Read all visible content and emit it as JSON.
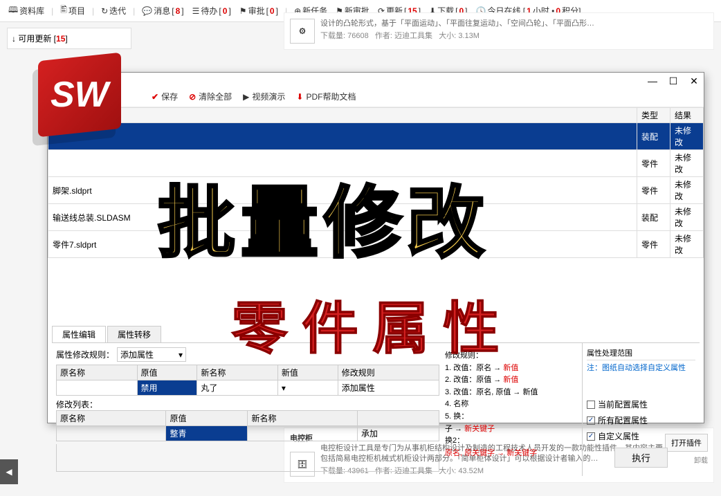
{
  "menu": {
    "items": [
      {
        "label": "资料库"
      },
      {
        "label": "项目"
      },
      {
        "label": "迭代"
      },
      {
        "label": "消息",
        "num": "8"
      },
      {
        "label": "待办",
        "num": "0"
      },
      {
        "label": "审批",
        "num": "0"
      },
      {
        "label": "新任务"
      },
      {
        "label": "新审批"
      },
      {
        "label": "更新",
        "num": "15"
      },
      {
        "label": "下载",
        "num": "0"
      }
    ],
    "today": "今日在线 [",
    "today_hours": "1",
    "today_suffix": " 小时 • ",
    "points": "0",
    "points_suffix": " 积分]"
  },
  "update_box": {
    "icon": "↓",
    "text": "可用更新 [",
    "num": "15",
    "suffix": "]"
  },
  "sw_logo": "SW",
  "bg_card1": {
    "desc": "设计的凸轮形式，基于「平面运动」、「平面往复运动」、「空间凸轮」、「平面凸形…",
    "dl_label": "下载量:",
    "dl": "76608",
    "author_label": "作者:",
    "author": "迈迪工具集",
    "size_label": "大小:",
    "size": "3.13M"
  },
  "bg_card2": {
    "title": "电控柜",
    "desc": "电控柜设计工具是专门为从事机柜结构设计及制造的工程技术人员开发的一款功能性插件。其内容主要包括简易电控柜机械式机柜设计两部分。「简单柜体设计」可以根据设计者输入的…",
    "dl_label": "下载量:",
    "dl": "43961",
    "author_label": "作者:",
    "author": "迈迪工具集",
    "size_label": "大小:",
    "size": "43.52M",
    "btn": "打开插件",
    "btn2": "卸载"
  },
  "dialog": {
    "toolbar": {
      "clear": "清除全部",
      "video": "视频演示",
      "pdf": "PDF帮助文档",
      "save": "保存"
    },
    "headers": {
      "name": "",
      "type": "类型",
      "status": "结果"
    },
    "rows": [
      {
        "name": "",
        "type": "装配",
        "status": "未修改",
        "selected": true
      },
      {
        "name": "",
        "type": "零件",
        "status": "未修改"
      },
      {
        "name": "脚架.sldprt",
        "type": "零件",
        "status": "未修改"
      },
      {
        "name": "输送线总装.SLDASM",
        "type": "装配",
        "status": "未修改"
      },
      {
        "name": "零件7.sldprt",
        "type": "零件",
        "status": "未修改"
      }
    ],
    "tabs": {
      "edit": "属性编辑",
      "move": "属性转移"
    },
    "rule_label": "属性修改规则：",
    "rule_select": "添加属性",
    "grid1": {
      "h1": "原名称",
      "h2": "原值",
      "h3": "新名称",
      "h4": "新值",
      "h5": "修改规则",
      "r2": "禁用",
      "r3": "丸了",
      "r5": "添加属性"
    },
    "list_label": "修改列表：",
    "grid2": {
      "h1": "原名称",
      "h2": "原值",
      "h3": "新名称",
      "r2": "整青",
      "r4": "承加"
    },
    "rules_title": "修改规则：",
    "rules": [
      {
        "pre": "1. 改值：原名 → ",
        "post": "新值"
      },
      {
        "pre": "2. 改值：原值 → ",
        "post": "新值"
      },
      {
        "pre": "3. 改值：原名, 原值 → 新值"
      },
      {
        "pre": "4. 名称",
        "post": ""
      },
      {
        "pre": "5. 换：",
        "post": ""
      },
      {
        "pre": "子 → ",
        "post": "新关键子"
      },
      {
        "pre": "换2：",
        "post": ""
      },
      {
        "pre": "原名, 原关键字 → ",
        "post": "新关键字"
      }
    ],
    "scope_title": "属性处理范围",
    "note": "注：图纸自动选择自定义属性",
    "cb1": "当前配置属性",
    "cb2": "所有配置属性",
    "cb3": "自定义属性",
    "exec": "执行"
  },
  "overlay": {
    "line1": "批量修改",
    "line2": "零件属性"
  }
}
